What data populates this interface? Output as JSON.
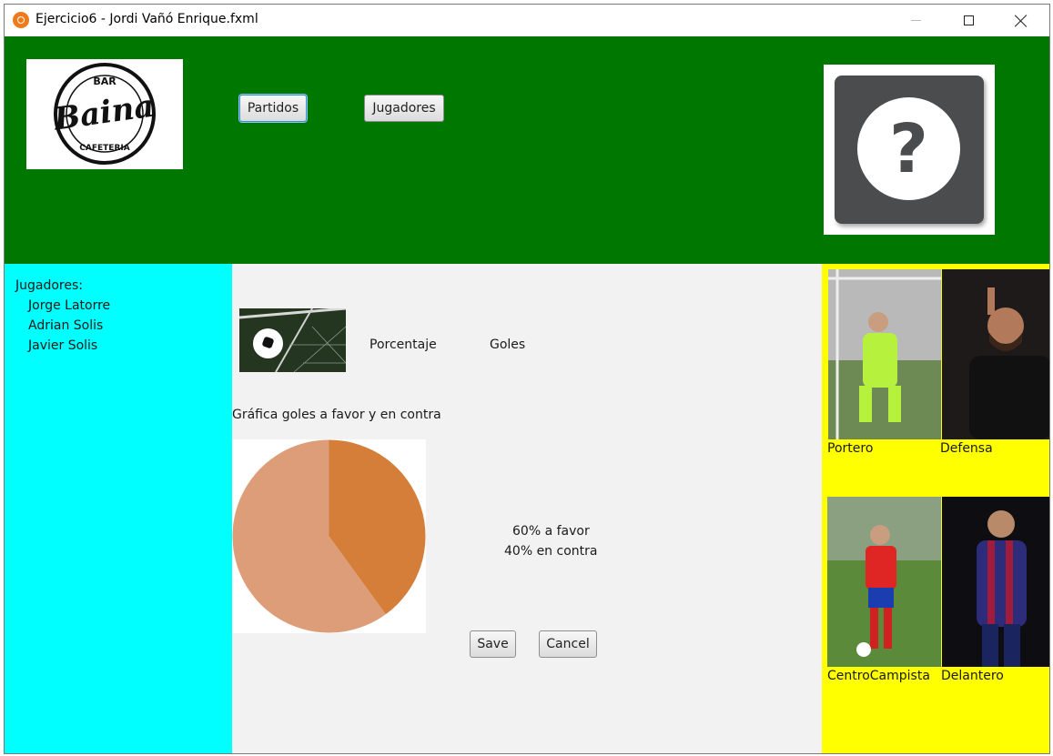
{
  "window": {
    "title": "Ejercicio6 - Jordi Vañó Enrique.fxml"
  },
  "header": {
    "logo": {
      "top_text": "BAR",
      "brand_text": "Baina",
      "bottom_text": "CAFETERIA"
    },
    "nav": {
      "partidos_label": "Partidos",
      "jugadores_label": "Jugadores"
    },
    "help_icon": "question-mark-icon",
    "colors": {
      "header_bg": "#007800"
    }
  },
  "left_panel": {
    "heading": "Jugadores:",
    "players": [
      "Jorge Latorre",
      "Adrian Solis",
      "Javier Solis"
    ],
    "colors": {
      "bg": "#00ffff"
    }
  },
  "center": {
    "porcentaje_label": "Porcentaje",
    "goles_label": "Goles",
    "chart_heading": "Gráfica goles a favor y en contra",
    "favor_text": "60% a favor",
    "contra_text": "40% en contra",
    "save_label": "Save",
    "cancel_label": "Cancel"
  },
  "chart_data": {
    "type": "pie",
    "categories": [
      "a favor",
      "en contra"
    ],
    "values": [
      60,
      40
    ],
    "colors": [
      "#dd9d78",
      "#d57e3a"
    ]
  },
  "right_panel": {
    "positions": [
      "Portero",
      "Defensa",
      "CentroCampista",
      "Delantero"
    ],
    "colors": {
      "bg": "#ffff00"
    }
  }
}
